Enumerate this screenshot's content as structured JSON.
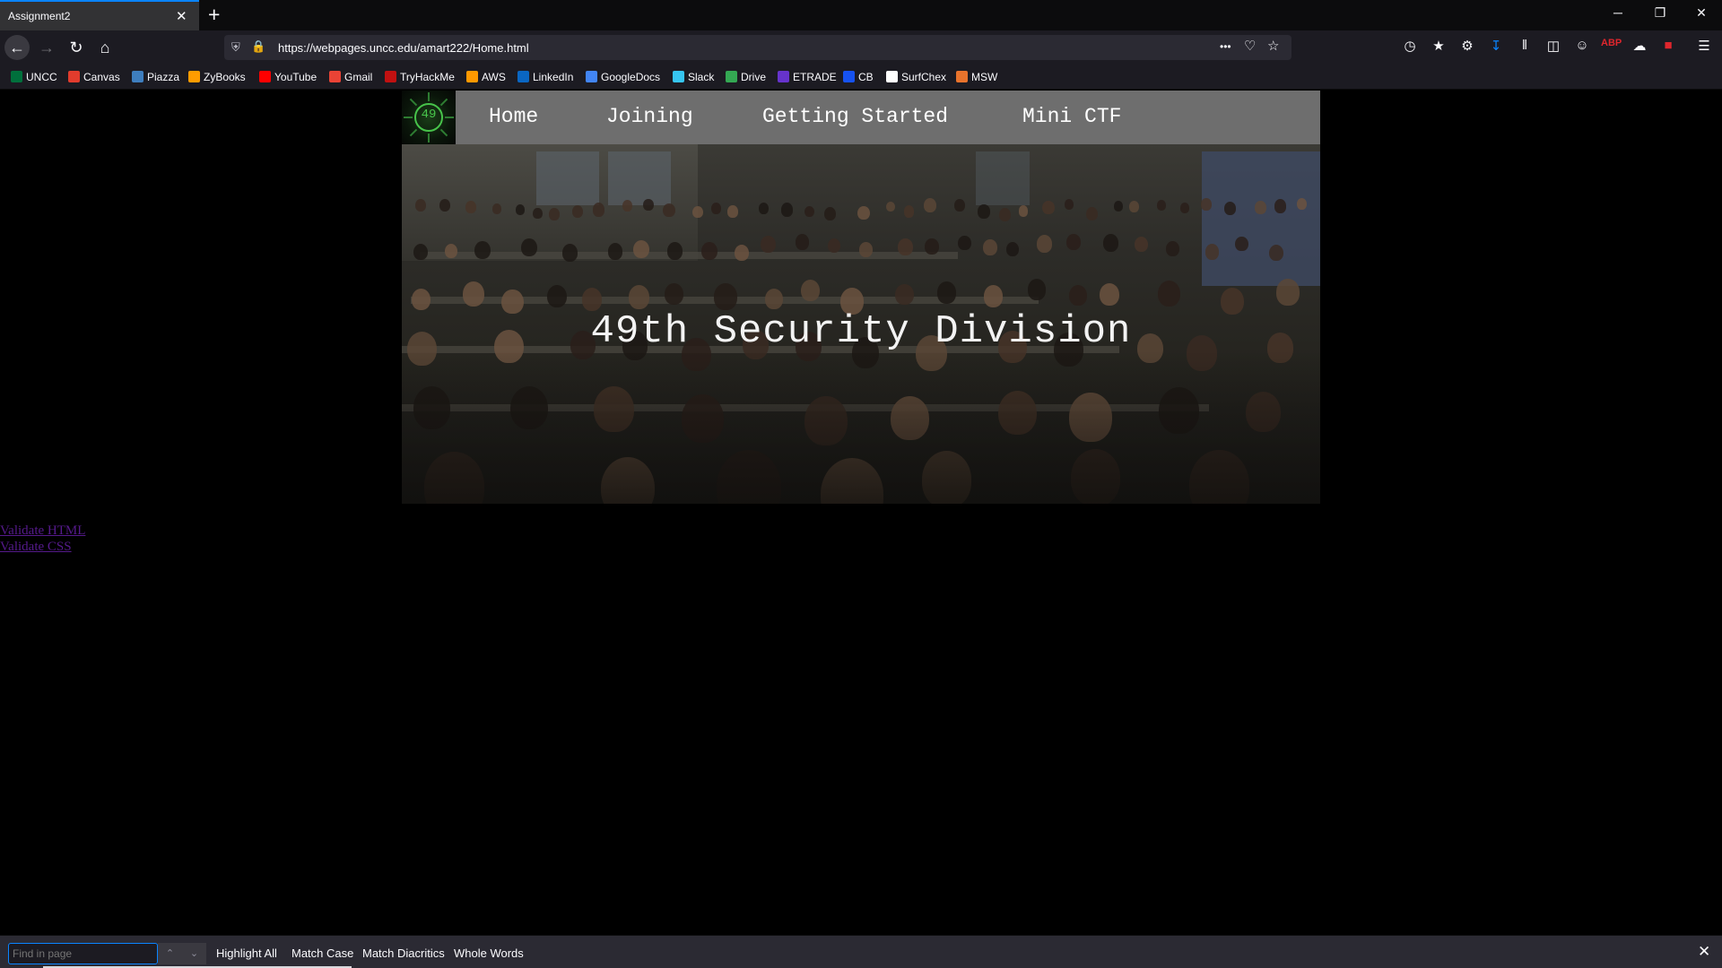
{
  "browser": {
    "tab_title": "Assignment2",
    "tab_close": "✕",
    "new_tab": "+",
    "window": {
      "minimize": "─",
      "restore": "❐",
      "close": "✕"
    },
    "url": "https://webpages.uncc.edu/amart222/Home.html",
    "more_label": "•••",
    "bookmarks": [
      {
        "label": "UNCC",
        "color": "#00703c"
      },
      {
        "label": "Canvas",
        "color": "#e23c2d"
      },
      {
        "label": "Piazza",
        "color": "#3e7ebe"
      },
      {
        "label": "ZyBooks",
        "color": "#ff9c00"
      },
      {
        "label": "YouTube",
        "color": "#ff0000"
      },
      {
        "label": "Gmail",
        "color": "#ea4335"
      },
      {
        "label": "TryHackMe",
        "color": "#c11111"
      },
      {
        "label": "AWS",
        "color": "#ff9900"
      },
      {
        "label": "LinkedIn",
        "color": "#0a66c2"
      },
      {
        "label": "GoogleDocs",
        "color": "#4285f4"
      },
      {
        "label": "Slack",
        "color": "#36c5f0"
      },
      {
        "label": "Drive",
        "color": "#34a853"
      },
      {
        "label": "ETRADE",
        "color": "#6633cc"
      },
      {
        "label": "CB",
        "color": "#1652f0"
      },
      {
        "label": "SurfChex",
        "color": "#ffffff"
      },
      {
        "label": "MSW",
        "color": "#e8732c"
      }
    ]
  },
  "site": {
    "logo_text": "49",
    "nav": [
      "Home",
      "Joining",
      "Getting Started",
      "Mini CTF"
    ],
    "hero_title": "49th Security Division",
    "validate_html": "Validate HTML",
    "validate_css": "Validate CSS"
  },
  "findbar": {
    "placeholder": "Find in page",
    "highlight_all": "Highlight All",
    "match_case": "Match Case",
    "match_diacritics": "Match Diacritics",
    "whole_words": "Whole Words",
    "close": "✕"
  },
  "colors": {
    "accent": "#0a84ff",
    "site_nav_bg": "#6e6e6e",
    "visited_link": "#551a8b",
    "logo_green": "#47c34a"
  }
}
